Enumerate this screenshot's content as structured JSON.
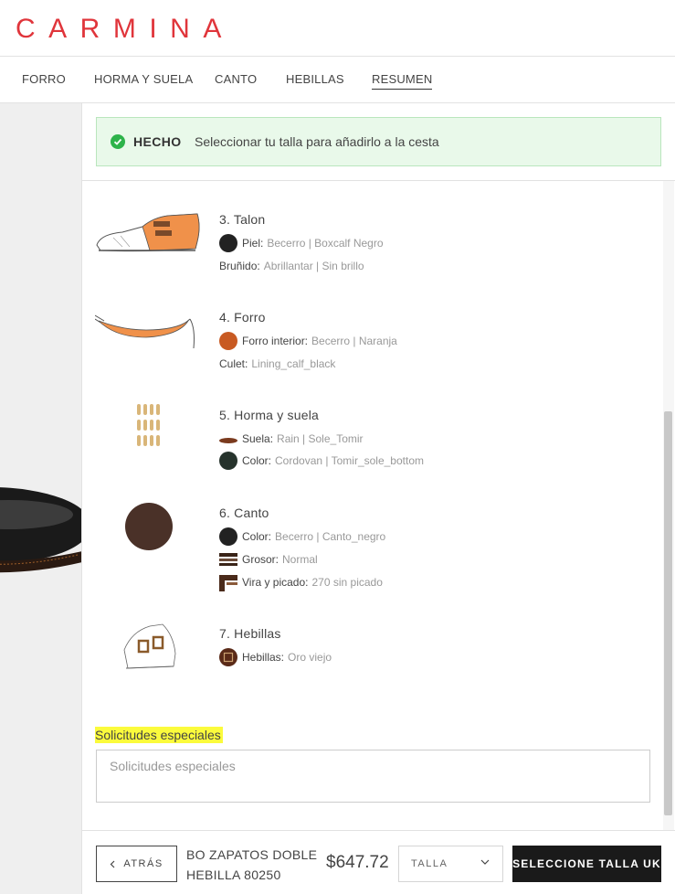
{
  "brand": {
    "logo": "CARMINA",
    "color": "#e0353b"
  },
  "nav": {
    "items": [
      {
        "label": "FORRO",
        "active": false
      },
      {
        "label": "HORMA Y SUELA",
        "active": false
      },
      {
        "label": "CANTO",
        "active": false
      },
      {
        "label": "HEBILLAS",
        "active": false
      },
      {
        "label": "RESUMEN",
        "active": true
      }
    ]
  },
  "banner": {
    "status": "HECHO",
    "message": "Seleccionar tu talla para añadirlo a la cesta",
    "icon": "check-circle-icon",
    "color": "#2db34a"
  },
  "sections": [
    {
      "title": "3. Talon",
      "image_icon": "shoe-heel-icon",
      "rows": [
        {
          "label": "Piel:",
          "value": "Becerro | Boxcalf Negro",
          "swatch": "#222222"
        },
        {
          "label": "Bruñido:",
          "value": "Abrillantar | Sin brillo"
        }
      ]
    },
    {
      "title": "4. Forro",
      "image_icon": "lining-icon",
      "rows": [
        {
          "label": "Forro interior:",
          "value": "Becerro | Naranja",
          "swatch": "#c85a22"
        },
        {
          "label": "Culet:",
          "value": "Lining_calf_black"
        }
      ]
    },
    {
      "title": "5. Horma y suela",
      "image_icon": "last-sole-icon",
      "rows": [
        {
          "label": "Suela:",
          "value": "Rain | Sole_Tomir",
          "swatch": "#6a3a22"
        },
        {
          "label": "Color:",
          "value": "Cordovan | Tomir_sole_bottom",
          "swatch": "#26332c"
        }
      ]
    },
    {
      "title": "6. Canto",
      "image_icon": "edge-color-icon",
      "rows": [
        {
          "label": "Color:",
          "value": "Becerro | Canto_negro",
          "swatch": "#222222"
        },
        {
          "label": "Grosor:",
          "value": "Normal",
          "swatch": "#3a2418"
        },
        {
          "label": "Vira y picado:",
          "value": "270 sin picado",
          "swatch": "#4a2a1a"
        }
      ]
    },
    {
      "title": "7. Hebillas",
      "image_icon": "buckle-icon",
      "rows": [
        {
          "label": "Hebillas:",
          "value": "Oro viejo",
          "swatch": "#5a2a18"
        }
      ]
    }
  ],
  "special_requests": {
    "label": "Solicitudes especiales",
    "placeholder": "Solicitudes especiales",
    "value": ""
  },
  "footer": {
    "back_label": "ATRÁS",
    "product_name": "BO ZAPATOS DOBLE HEBILLA 80250",
    "price": "$647.72",
    "size_label": "TALLA",
    "cta_label": "SELECCIONE TALLA UK"
  }
}
